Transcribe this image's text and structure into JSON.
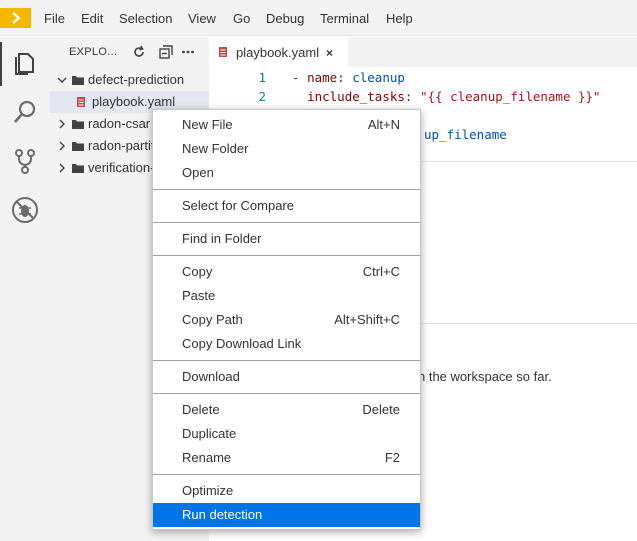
{
  "menubar": {
    "items": [
      {
        "label": "File"
      },
      {
        "label": "Edit"
      },
      {
        "label": "Selection"
      },
      {
        "label": "View"
      },
      {
        "label": "Go"
      },
      {
        "label": "Debug"
      },
      {
        "label": "Terminal"
      },
      {
        "label": "Help"
      }
    ]
  },
  "activitybar": {
    "icons": [
      "explorer-icon",
      "search-icon",
      "source-control-icon",
      "debug-icon"
    ]
  },
  "sidebar": {
    "title": "EXPLO...",
    "tree": [
      {
        "label": "defect-prediction",
        "expanded": true
      },
      {
        "label": "playbook.yaml",
        "selected": true
      },
      {
        "label": "radon-csar"
      },
      {
        "label": "radon-partit"
      },
      {
        "label": "verification-"
      }
    ]
  },
  "editor": {
    "tab": {
      "label": "playbook.yaml",
      "close": "×"
    },
    "lines": [
      {
        "num": "1",
        "dash": "- ",
        "key": "name",
        "sep": ": ",
        "value": "cleanup"
      },
      {
        "num": "2",
        "dash": "  ",
        "key": "include_tasks",
        "sep": ": ",
        "value": "\"{{ cleanup_filename }}\""
      },
      {
        "value": "up_filename"
      }
    ]
  },
  "panel": {
    "message_tail": "n the workspace so far."
  },
  "context_menu": {
    "groups": [
      [
        {
          "label": "New File",
          "shortcut": "Alt+N"
        },
        {
          "label": "New Folder",
          "shortcut": ""
        },
        {
          "label": "Open",
          "shortcut": ""
        }
      ],
      [
        {
          "label": "Select for Compare",
          "shortcut": ""
        }
      ],
      [
        {
          "label": "Find in Folder",
          "shortcut": ""
        }
      ],
      [
        {
          "label": "Copy",
          "shortcut": "Ctrl+C"
        },
        {
          "label": "Paste",
          "shortcut": ""
        },
        {
          "label": "Copy Path",
          "shortcut": "Alt+Shift+C"
        },
        {
          "label": "Copy Download Link",
          "shortcut": ""
        }
      ],
      [
        {
          "label": "Download",
          "shortcut": ""
        }
      ],
      [
        {
          "label": "Delete",
          "shortcut": "Delete"
        },
        {
          "label": "Duplicate",
          "shortcut": ""
        },
        {
          "label": "Rename",
          "shortcut": "F2"
        }
      ],
      [
        {
          "label": "Optimize",
          "shortcut": ""
        },
        {
          "label": "Run detection",
          "shortcut": "",
          "highlighted": true
        }
      ]
    ]
  },
  "colors": {
    "accent": "#0074e8",
    "logo": "#f5b700",
    "yaml_file_icon": "#c5454d"
  }
}
